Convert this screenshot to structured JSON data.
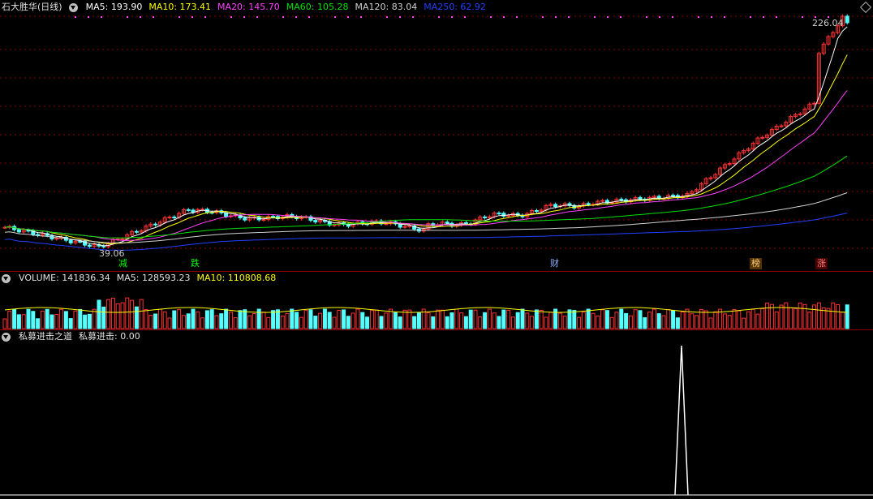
{
  "main": {
    "title": "石大胜华(日线)",
    "ma": [
      {
        "label": "MA5:",
        "value": "193.90",
        "color": "#ffffff"
      },
      {
        "label": "MA10:",
        "value": "173.41",
        "color": "#ffff00"
      },
      {
        "label": "MA20:",
        "value": "145.70",
        "color": "#ff40ff"
      },
      {
        "label": "MA60:",
        "value": "105.28",
        "color": "#00e000"
      },
      {
        "label": "MA120:",
        "value": "83.04",
        "color": "#d0d0d0"
      },
      {
        "label": "MA250:",
        "value": "62.92",
        "color": "#2040ff"
      }
    ],
    "high_label": "226.04",
    "low_label": "39.06",
    "markers": [
      "减",
      "跌",
      "财",
      "榜",
      "涨"
    ]
  },
  "volume": {
    "label": "VOLUME:",
    "value": "141836.34",
    "ma5_label": "MA5:",
    "ma5_value": "128593.23",
    "ma10_label": "MA10:",
    "ma10_value": "110808.68"
  },
  "indicator": {
    "name": "私募进击之道",
    "line_label": "私募进击:",
    "line_value": "0.00"
  },
  "colors": {
    "up": "#ff3232",
    "down": "#54ffff",
    "grid": "#8a0000"
  }
}
